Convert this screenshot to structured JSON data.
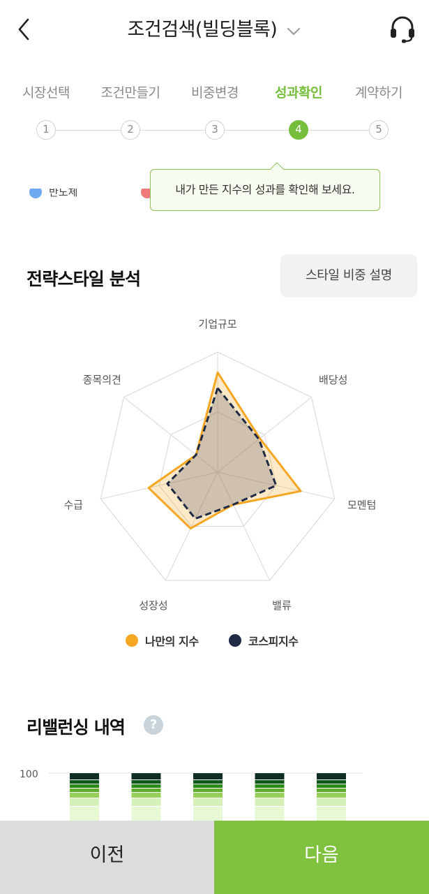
{
  "header": {
    "title": "조건검색(빌딩블록)",
    "back_icon": "chevron-left-icon",
    "title_dropdown_icon": "chevron-down-icon",
    "support_icon": "headset-icon"
  },
  "steps": [
    {
      "label": "시장선택",
      "number": "1",
      "active": false
    },
    {
      "label": "조건만들기",
      "number": "2",
      "active": false
    },
    {
      "label": "비중변경",
      "number": "3",
      "active": false
    },
    {
      "label": "성과확인",
      "number": "4",
      "active": true
    },
    {
      "label": "계약하기",
      "number": "5",
      "active": false
    }
  ],
  "tooltip": {
    "text": "내가 만든 지수의 성과를 확인해 보세요."
  },
  "hidden_legend": {
    "item1": "반도체",
    "item1_color": "#6ea8f0",
    "item2_color": "#f07b7b"
  },
  "strategy": {
    "title": "전략스타일 분석",
    "style_button": "스타일 비중 설명"
  },
  "chart_data": {
    "type": "radar",
    "axes": [
      "기업규모",
      "배당성",
      "모멘텀",
      "밸류",
      "성장성",
      "수급",
      "종목의견"
    ],
    "range": [
      0,
      100
    ],
    "grid": true,
    "series": [
      {
        "name": "나만의 지수",
        "color": "#f5a623",
        "values": [
          83,
          45,
          71,
          30,
          52,
          59,
          23
        ]
      },
      {
        "name": "코스피지수",
        "color": "#1f2a44",
        "values": [
          70,
          44,
          50,
          30,
          43,
          43,
          23
        ]
      }
    ]
  },
  "legend": [
    {
      "label": "나만의 지수",
      "color": "#f5a623"
    },
    {
      "label": "코스피지수",
      "color": "#1f2a44"
    }
  ],
  "rebalancing": {
    "title": "리밸런싱 내역",
    "help_icon": "question-mark-icon",
    "help_glyph": "?",
    "y_tick": "100",
    "bar_count": 5,
    "segment_colors": [
      "#0f2f24",
      "#0f5a1b",
      "#2f8a1e",
      "#5fae2c",
      "#98cf5c",
      "#d5f0b8",
      "#e6f8d4"
    ]
  },
  "buttons": {
    "prev": "이전",
    "next": "다음"
  }
}
